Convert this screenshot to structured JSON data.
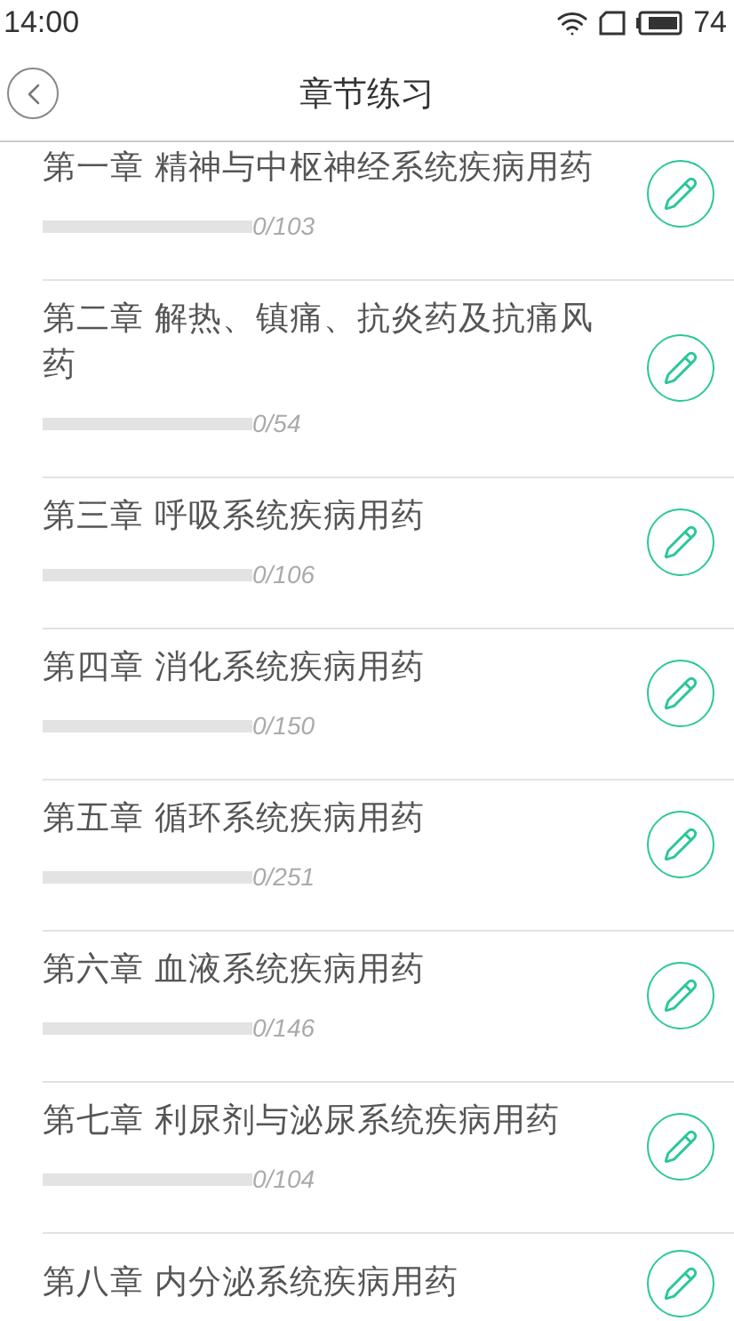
{
  "status_bar": {
    "time": "14:00",
    "battery": "74"
  },
  "header": {
    "title": "章节练习"
  },
  "chapters": [
    {
      "title": "第一章 精神与中枢神经系统疾病用药",
      "count": "0/103",
      "level": 0
    },
    {
      "title": "第二章 解热、镇痛、抗炎药及抗痛风药",
      "count": "0/54",
      "level": 0
    },
    {
      "title": "第三章 呼吸系统疾病用药",
      "count": "0/106",
      "level": 0
    },
    {
      "title": "第四章 消化系统疾病用药",
      "count": "0/150",
      "level": 0
    },
    {
      "title": "第五章 循环系统疾病用药",
      "count": "0/251",
      "level": 0
    },
    {
      "title": "第六章 血液系统疾病用药",
      "count": "0/146",
      "level": 0
    },
    {
      "title": "第七章 利尿剂与泌尿系统疾病用药",
      "count": "0/104",
      "level": 0
    },
    {
      "title": "第八章 内分泌系统疾病用药"
    }
  ]
}
